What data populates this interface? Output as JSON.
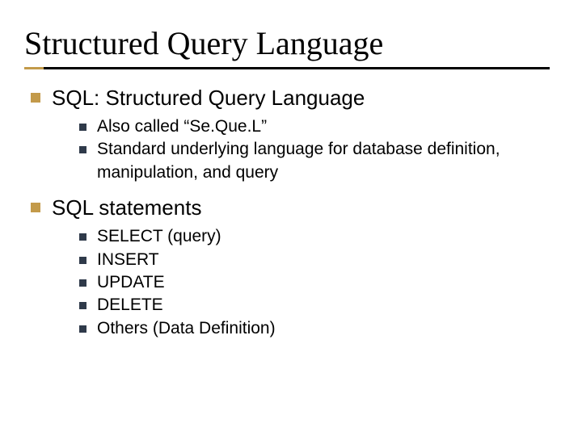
{
  "title": "Structured Query Language",
  "items": [
    {
      "label": "SQL:  Structured Query Language",
      "sub": [
        "Also called “Se.Que.L”",
        "Standard underlying language for database definition, manipulation, and query"
      ]
    },
    {
      "label": "SQL statements",
      "sub": [
        "SELECT (query)",
        "INSERT",
        "UPDATE",
        "DELETE",
        "Others (Data Definition)"
      ]
    }
  ]
}
